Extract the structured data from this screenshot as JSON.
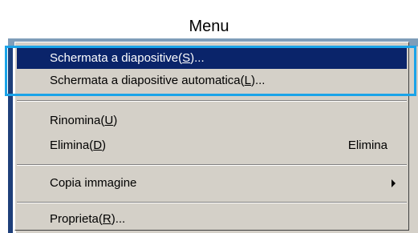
{
  "title": "Menu",
  "menu": {
    "items": [
      {
        "prefix": "Schermata a diapositive(",
        "accel": "S",
        "suffix": ")...",
        "shortcut": "",
        "selected": true
      },
      {
        "prefix": "Schermata a diapositive automatica(",
        "accel": "L",
        "suffix": ")...",
        "shortcut": "",
        "selected": false
      },
      {
        "prefix": "Rinomina(",
        "accel": "U",
        "suffix": ")",
        "shortcut": "",
        "selected": false
      },
      {
        "prefix": "Elimina(",
        "accel": "D",
        "suffix": ")",
        "shortcut": "Elimina",
        "selected": false
      },
      {
        "prefix": "Copia immagine",
        "accel": "",
        "suffix": "",
        "shortcut": "",
        "selected": false,
        "submenu_icon": "chevron-right-icon"
      },
      {
        "prefix": "Proprieta(",
        "accel": "R",
        "suffix": ")...",
        "shortcut": "",
        "selected": false
      }
    ]
  },
  "colors": {
    "menu_bg": "#d4d0c8",
    "selection_bg": "#0a246a",
    "highlight_box": "#1aa3e8"
  }
}
